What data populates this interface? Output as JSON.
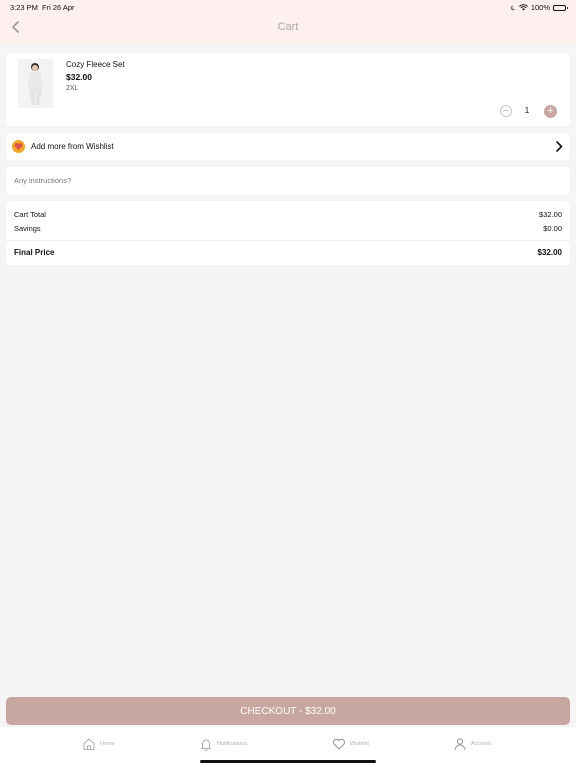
{
  "status": {
    "time": "3:23 PM",
    "date": "Fri 26 Apr",
    "battery": "100%"
  },
  "header": {
    "title": "Cart"
  },
  "cart_item": {
    "name": "Cozy Fleece Set",
    "price": "$32.00",
    "size": "2XL",
    "quantity": "1"
  },
  "wishlist_row": {
    "label": "Add more from Wishlist"
  },
  "instructions": {
    "placeholder": "Any instructions?"
  },
  "summary": {
    "cart_total_label": "Cart Total",
    "cart_total": "$32.00",
    "savings_label": "Savings",
    "savings": "$0.00",
    "final_label": "Final Price",
    "final": "$32.00"
  },
  "checkout": {
    "label": "CHECKOUT - $32.00"
  },
  "tabs": [
    {
      "label": "Home",
      "icon": "home-icon"
    },
    {
      "label": "Notifications",
      "icon": "bell-icon"
    },
    {
      "label": "Wishlist",
      "icon": "heart-icon"
    },
    {
      "label": "Account",
      "icon": "user-icon"
    }
  ],
  "colors": {
    "accent": "#c9a7a1",
    "header_bg": "#fdf0ee",
    "wishlist_badge": "#f5a623"
  }
}
